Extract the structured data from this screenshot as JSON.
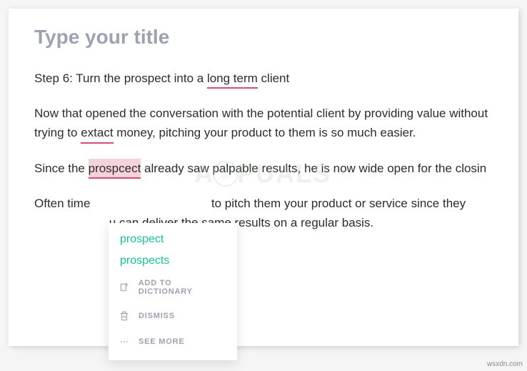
{
  "editor": {
    "title_placeholder": "Type your title",
    "paragraphs": {
      "p1": {
        "before": "Step 6: Turn the prospect into a ",
        "underlined": "long term",
        "after": " client"
      },
      "p2": {
        "before": "Now that opened the conversation with the potential client by providing value without trying to ",
        "underlined": "extact",
        "after": " money, pitching your product to them is so much easier."
      },
      "p3": {
        "before": "Since the ",
        "error": "prospcect",
        "after": " already saw palpable results, he is now wide open for the closin"
      },
      "p4": {
        "before": "Often time",
        "middle": "to pitch them your product or service since they",
        "after": "u can deliver the same results on a regular basis."
      }
    }
  },
  "suggestion_menu": {
    "suggestions": [
      "prospect",
      "prospects"
    ],
    "actions": {
      "add": "ADD TO DICTIONARY",
      "dismiss": "DISMISS",
      "see_more": "SEE MORE"
    }
  },
  "watermark": {
    "left": "A",
    "right": "PUALS"
  },
  "footer": {
    "credit": "wsxdn.com"
  }
}
